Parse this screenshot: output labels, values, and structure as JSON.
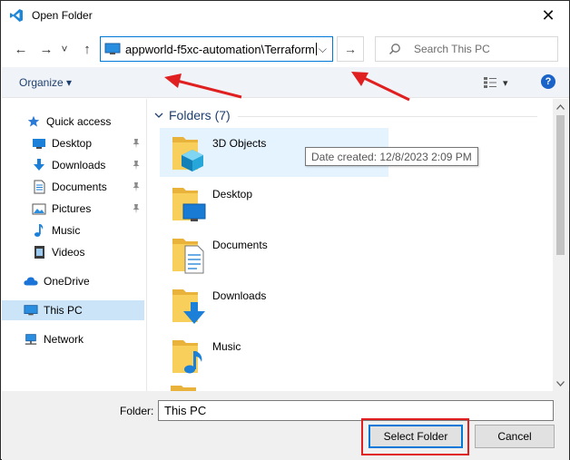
{
  "window": {
    "title": "Open Folder",
    "close_glyph": "✕"
  },
  "nav": {
    "back_glyph": "←",
    "forward_glyph": "→",
    "recent_glyph": "˅",
    "up_glyph": "↑",
    "address_path": "appworld-f5xc-automation\\Terraform",
    "address_dropdown_glyph": "⌵",
    "go_glyph": "→",
    "search_placeholder": "Search This PC"
  },
  "commandbar": {
    "organize_label": "Organize ▾",
    "view_dropdown_glyph": "▾",
    "help_label": "?"
  },
  "sidebar": {
    "items": [
      {
        "label": "Quick access",
        "icon": "star-icon",
        "pinned": false
      },
      {
        "label": "Desktop",
        "icon": "desktop-icon",
        "pinned": true
      },
      {
        "label": "Downloads",
        "icon": "download-icon",
        "pinned": true
      },
      {
        "label": "Documents",
        "icon": "document-icon",
        "pinned": true
      },
      {
        "label": "Pictures",
        "icon": "pictures-icon",
        "pinned": true
      },
      {
        "label": "Music",
        "icon": "music-icon",
        "pinned": false
      },
      {
        "label": "Videos",
        "icon": "video-icon",
        "pinned": false
      },
      {
        "label": "OneDrive",
        "icon": "cloud-icon",
        "pinned": false
      },
      {
        "label": "This PC",
        "icon": "computer-icon",
        "pinned": false,
        "selected": true
      },
      {
        "label": "Network",
        "icon": "network-icon",
        "pinned": false
      }
    ]
  },
  "content": {
    "group_label": "Folders (7)",
    "folders": [
      {
        "name": "3D Objects",
        "icon": "3d-objects-folder-icon",
        "hovered": true
      },
      {
        "name": "Desktop",
        "icon": "desktop-folder-icon"
      },
      {
        "name": "Documents",
        "icon": "documents-folder-icon"
      },
      {
        "name": "Downloads",
        "icon": "downloads-folder-icon"
      },
      {
        "name": "Music",
        "icon": "music-folder-icon"
      }
    ],
    "tooltip": "Date created: 12/8/2023 2:09 PM"
  },
  "footer": {
    "folder_label": "Folder:",
    "folder_value": "This PC",
    "select_button": "Select Folder",
    "cancel_button": "Cancel"
  },
  "colors": {
    "accent": "#0078d7",
    "annotation": "#e02020",
    "folder_yellow": "#f4c542",
    "selection": "#cce4f7",
    "hover": "#e5f3ff"
  }
}
